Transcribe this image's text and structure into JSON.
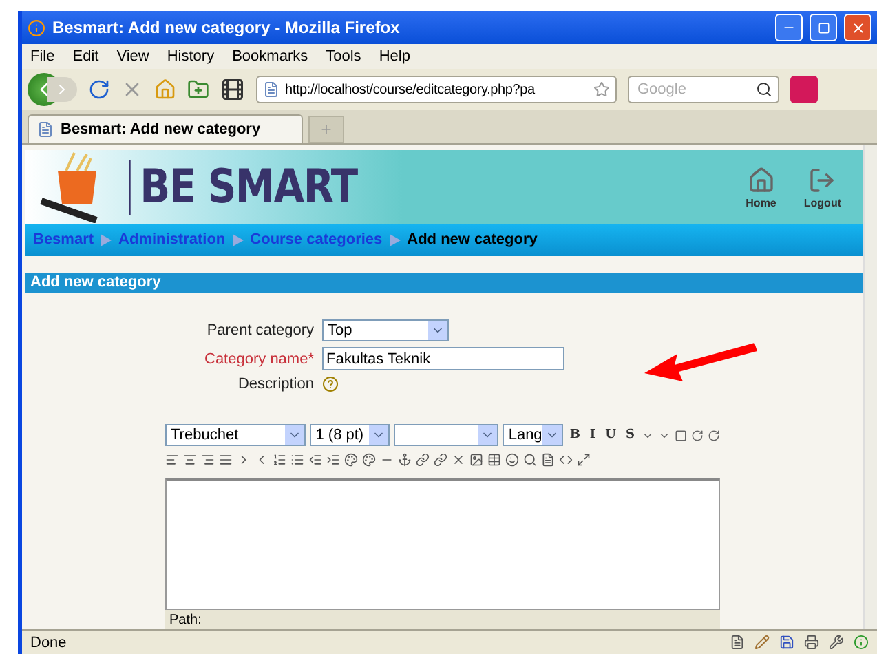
{
  "window": {
    "title": "Besmart: Add new category - Mozilla Firefox"
  },
  "menu": [
    "File",
    "Edit",
    "View",
    "History",
    "Bookmarks",
    "Tools",
    "Help"
  ],
  "address_bar": {
    "value": "http://localhost/course/editcategory.php?pa"
  },
  "search": {
    "placeholder": "Google"
  },
  "tabs": [
    {
      "label": "Besmart: Add new category",
      "selected": true
    }
  ],
  "site": {
    "logo_text": "BE SMART",
    "header_links": [
      "Home",
      "Logout"
    ]
  },
  "breadcrumb": [
    {
      "label": "Besmart",
      "current": false
    },
    {
      "label": "Administration",
      "current": false
    },
    {
      "label": "Course categories",
      "current": false
    },
    {
      "label": "Add new category",
      "current": true
    }
  ],
  "page_heading": "Add new category",
  "form": {
    "fields": [
      {
        "kind": "select",
        "label": "Parent category",
        "value": "Top",
        "required": false
      },
      {
        "kind": "text",
        "label": "Category name*",
        "value": "Fakultas Teknik",
        "required": true
      },
      {
        "kind": "help",
        "label": "Description",
        "required": false
      }
    ]
  },
  "editor": {
    "selects": [
      {
        "kind": "font",
        "value": "Trebuchet"
      },
      {
        "kind": "size",
        "value": "1 (8 pt)"
      },
      {
        "kind": "format"
      },
      {
        "kind": "lang",
        "value": "Lang"
      }
    ],
    "format_buttons": [
      "B",
      "I",
      "U",
      "S"
    ],
    "path_label": "Path:"
  },
  "status_bar": {
    "text": "Done"
  }
}
